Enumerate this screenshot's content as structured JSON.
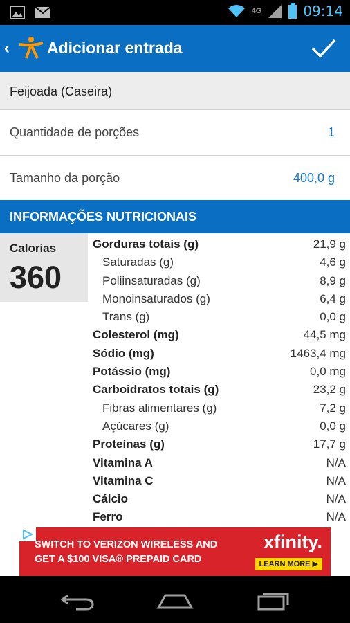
{
  "status_bar": {
    "time": "09:14",
    "network": "4G"
  },
  "app_bar": {
    "title": "Adicionar entrada"
  },
  "food": {
    "name": "Feijoada (Caseira)"
  },
  "servings": {
    "label": "Quantidade de porções",
    "value": "1"
  },
  "serving_size": {
    "label": "Tamanho da porção",
    "value": "400,0 g"
  },
  "nutrition": {
    "header": "INFORMAÇÕES NUTRICIONAIS",
    "calories_label": "Calorias",
    "calories_value": "360",
    "items": [
      {
        "name": "Gorduras totais (g)",
        "value": "21,9 g",
        "style": "bold"
      },
      {
        "name": "Saturadas (g)",
        "value": "4,6 g",
        "style": "sub"
      },
      {
        "name": "Poliinsaturadas (g)",
        "value": "8,9 g",
        "style": "sub"
      },
      {
        "name": "Monoinsaturados (g)",
        "value": "6,4 g",
        "style": "sub"
      },
      {
        "name": "Trans (g)",
        "value": "0,0 g",
        "style": "sub"
      },
      {
        "name": "Colesterol (mg)",
        "value": "44,5 mg",
        "style": "bold"
      },
      {
        "name": "Sódio (mg)",
        "value": "1463,4 mg",
        "style": "bold"
      },
      {
        "name": "Potássio (mg)",
        "value": "0,0 mg",
        "style": "bold"
      },
      {
        "name": "Carboidratos totais (g)",
        "value": "23,2 g",
        "style": "bold"
      },
      {
        "name": "Fibras alimentares (g)",
        "value": "7,2 g",
        "style": "sub"
      },
      {
        "name": "Açúcares (g)",
        "value": "0,0 g",
        "style": "sub"
      },
      {
        "name": "Proteínas (g)",
        "value": "17,7 g",
        "style": "bold"
      },
      {
        "name": "Vitamina A",
        "value": "N/A",
        "style": "bold"
      },
      {
        "name": "Vitamina C",
        "value": "N/A",
        "style": "bold"
      },
      {
        "name": "Cálcio",
        "value": "N/A",
        "style": "bold"
      },
      {
        "name": "Ferro",
        "value": "N/A",
        "style": "bold"
      }
    ]
  },
  "ad": {
    "line1": "SWITCH TO VERIZON WIRELESS AND",
    "line2": "GET A $100 VISA® PREPAID CARD",
    "brand": "xfinity.",
    "cta": "LEARN MORE ▶"
  },
  "colors": {
    "primary": "#0a6fc2",
    "value_blue": "#1a73c4",
    "ad_red": "#d8232a"
  },
  "icons": {
    "status_left": [
      "image-icon",
      "gmail-icon"
    ],
    "status_right": [
      "wifi-icon",
      "signal-icon",
      "battery-icon"
    ],
    "nav": [
      "back-icon",
      "home-icon",
      "recent-apps-icon"
    ]
  }
}
